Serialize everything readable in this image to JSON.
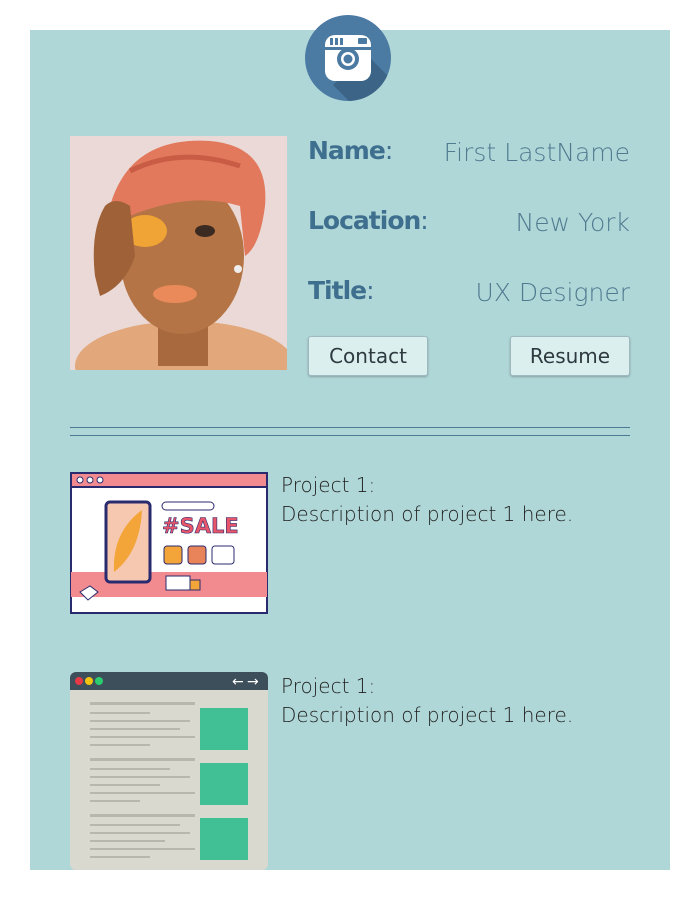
{
  "profile": {
    "name_label": "Name",
    "name_value": "First LastName",
    "location_label": "Location",
    "location_value": "New York",
    "title_label": "Title",
    "title_value": "UX Designer",
    "colon": ":"
  },
  "buttons": {
    "contact": "Contact",
    "resume": "Resume"
  },
  "projects": [
    {
      "title": "Project 1:",
      "description": "Description of project 1 here.",
      "thumb_text": "#SALE"
    },
    {
      "title": "Project 1:",
      "description": "Description of project 1 here."
    }
  ],
  "colors": {
    "panel": "#b0d7d8",
    "accent": "#3f6f8e",
    "logo": "#4b7aa3",
    "button": "#dcefef"
  },
  "icons": [
    "camera-icon",
    "arrow-left-icon",
    "arrow-right-icon"
  ]
}
